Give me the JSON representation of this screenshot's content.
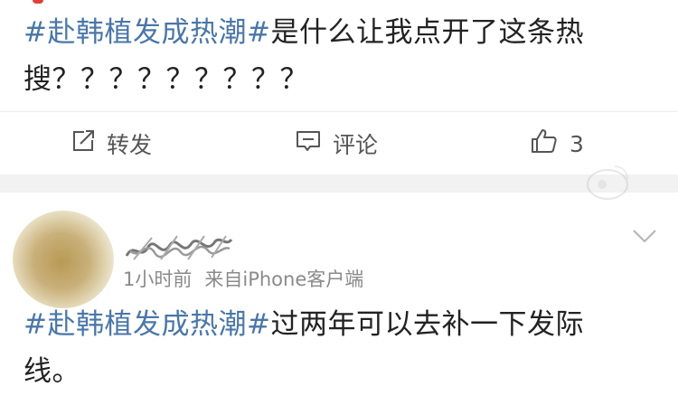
{
  "post1": {
    "hashtag": "#赴韩植发成热潮#",
    "text_line1": "是什么让我点开了这条热",
    "text_line2": "搜？？？？？？？？？"
  },
  "actions": {
    "forward_label": "转发",
    "comment_label": "评论",
    "like_count": "3"
  },
  "post2": {
    "username": "",
    "time": "1小时前",
    "source": "来自iPhone客户端",
    "hashtag": "#赴韩植发成热潮#",
    "text_line1": "过两年可以去补一下发际",
    "text_line2": "线。"
  },
  "colors": {
    "hashtag": "#4a76a8",
    "text": "#222222",
    "meta": "#8a8a8a",
    "separator": "#f2f2f2"
  },
  "icons": {
    "forward": "share-box-arrow-icon",
    "comment": "speech-bubble-icon",
    "like": "thumbs-up-icon",
    "more": "chevron-down-icon"
  }
}
